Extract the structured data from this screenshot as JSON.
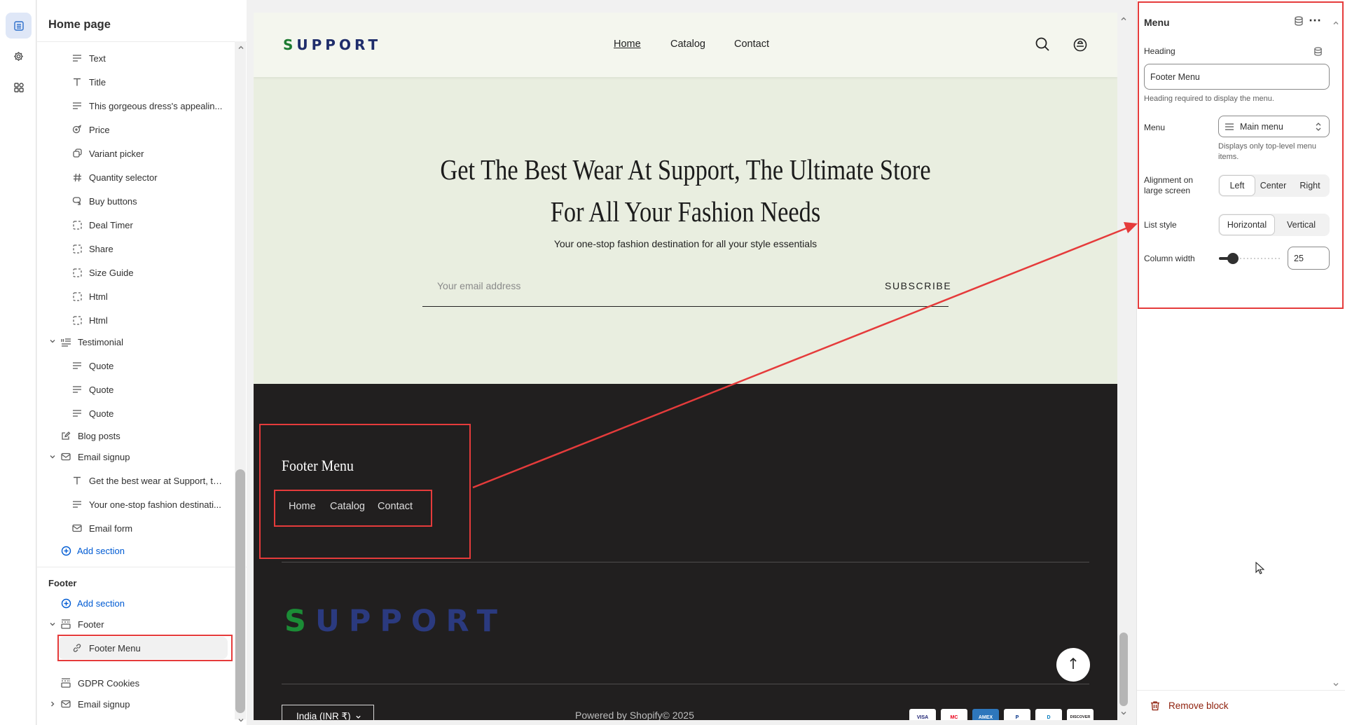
{
  "sidebar": {
    "title": "Home page",
    "items": [
      {
        "label": "Text",
        "icon": "text-lines-icon"
      },
      {
        "label": "Title",
        "icon": "text-t-icon"
      },
      {
        "label": "This gorgeous dress's appealin...",
        "icon": "text-lines-icon"
      },
      {
        "label": "Price",
        "icon": "price-tag-icon"
      },
      {
        "label": "Variant picker",
        "icon": "variant-picker-icon"
      },
      {
        "label": "Quantity selector",
        "icon": "hash-icon"
      },
      {
        "label": "Buy buttons",
        "icon": "buy-button-icon"
      },
      {
        "label": "Deal Timer",
        "icon": "dashed-square-icon"
      },
      {
        "label": "Share",
        "icon": "dashed-square-icon"
      },
      {
        "label": "Size Guide",
        "icon": "dashed-square-icon"
      },
      {
        "label": "Html",
        "icon": "dashed-square-icon"
      },
      {
        "label": "Html",
        "icon": "dashed-square-icon"
      }
    ],
    "testimonial": {
      "label": "Testimonial",
      "children": [
        "Quote",
        "Quote",
        "Quote"
      ]
    },
    "blog_posts": "Blog posts",
    "email_signup": {
      "label": "Email signup",
      "children": [
        "Get the best wear at Support, th...",
        "Your one-stop fashion destinati...",
        "Email form"
      ]
    },
    "add_section": "Add section",
    "footer_group": {
      "title": "Footer",
      "add_section": "Add section",
      "footer_section": "Footer",
      "footer_menu": "Footer Menu",
      "gdpr": "GDPR Cookies",
      "email_signup": "Email signup"
    }
  },
  "preview": {
    "brand": "SUPPORT",
    "brand_first": "S",
    "brand_rest": "UPPORT",
    "nav": [
      "Home",
      "Catalog",
      "Contact"
    ],
    "hero": {
      "heading_line1": "Get The Best Wear At Support, The Ultimate Store",
      "heading_line2": "For All Your Fashion Needs",
      "subheading": "Your one-stop fashion destination for all your style essentials",
      "email_placeholder": "Your email address",
      "subscribe": "SUBSCRIBE"
    },
    "footer": {
      "menu_heading": "Footer Menu",
      "links": [
        "Home",
        "Catalog",
        "Contact"
      ],
      "country": "India (INR ₹)",
      "powered": "Powered by Shopify© 2025",
      "payments": [
        "VISA",
        "MC",
        "AMEX",
        "P",
        "D",
        "DISCOVER"
      ]
    }
  },
  "panel": {
    "title": "Menu",
    "heading_label": "Heading",
    "heading_value": "Footer Menu",
    "heading_help": "Heading required to display the menu.",
    "menu_label": "Menu",
    "menu_value": "Main menu",
    "menu_help": "Displays only top-level menu items.",
    "alignment_label": "Alignment on large screen",
    "alignment_options": [
      "Left",
      "Center",
      "Right"
    ],
    "alignment_selected": "Left",
    "list_style_label": "List style",
    "list_style_options": [
      "Horizontal",
      "Vertical"
    ],
    "list_style_selected": "Horizontal",
    "column_width_label": "Column width",
    "column_width_value": "25",
    "remove_block": "Remove block"
  },
  "colors": {
    "accent_blue": "#005bd3",
    "highlight_red": "#e53b3b",
    "brand_navy": "#2b3a7f",
    "brand_green": "#1b8c36",
    "hero_bg": "#e9eee0",
    "footer_bg": "#211f1f",
    "remove_red": "#8e1f0b"
  }
}
